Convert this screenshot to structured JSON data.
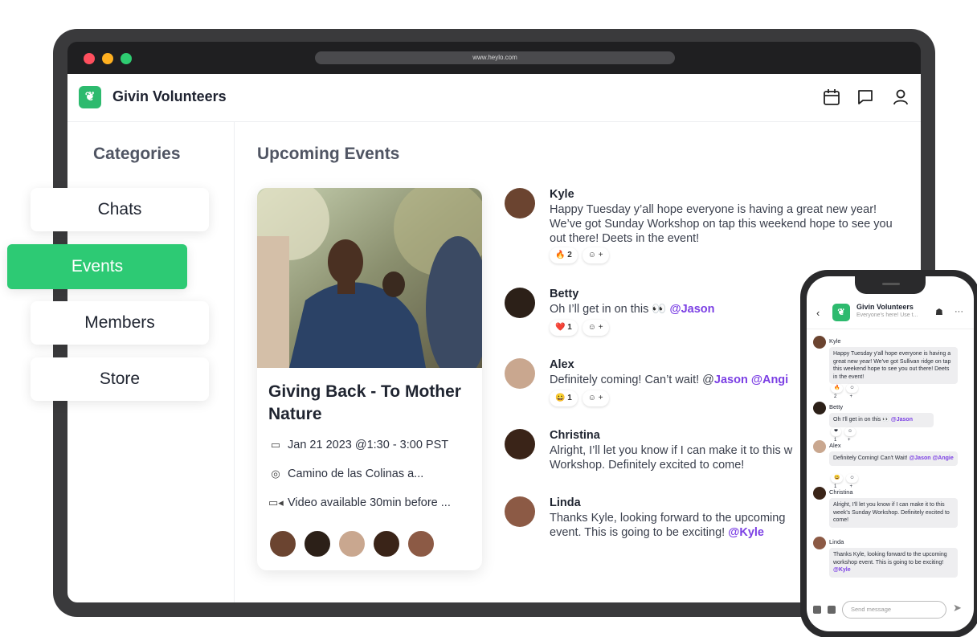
{
  "browser": {
    "url": "www.heylo.com"
  },
  "app": {
    "name": "Givin Volunteers"
  },
  "header_icons": [
    "calendar-icon",
    "chat-bubble-icon",
    "user-icon"
  ],
  "sidebar": {
    "title": "Categories",
    "items": [
      {
        "label": "Chats",
        "active": false
      },
      {
        "label": "Events",
        "active": true
      },
      {
        "label": "Members",
        "active": false
      },
      {
        "label": "Store",
        "active": false
      }
    ]
  },
  "main": {
    "title": "Upcoming Events",
    "event": {
      "name": "Giving Back - To Mother Nature",
      "date": "Jan 21 2023 @1:30 - 3:00 PST",
      "location": "Camino de las Colinas a...",
      "video": "Video available 30min before ..."
    },
    "messages": [
      {
        "name": "Kyle",
        "text": "Happy Tuesday y’all hope everyone is having a great new year! We’ve got Sunday Workshop on tap this weekend hope to see you out there! Deets in the event!",
        "reaction": "🔥",
        "count": "2"
      },
      {
        "name": "Betty",
        "text": "Oh I’ll get in on this 👀 ",
        "mention": "@Jason",
        "reaction": "❤️",
        "count": "1"
      },
      {
        "name": "Alex",
        "text": "Definitely coming! Can’t wait! @",
        "mention": "Jason @Angi",
        "reaction": "😀",
        "count": "1"
      },
      {
        "name": "Christina",
        "text": "Alright, I’ll let you know if I can make it to this w Workshop. Definitely excited to come!"
      },
      {
        "name": "Linda",
        "text": "Thanks Kyle, looking forward to the upcoming event. This is going to be exciting! ",
        "mention": "@Kyle"
      }
    ],
    "add_reaction": "☺ +"
  },
  "phone": {
    "title": "Givin Volunteers",
    "subtitle": "Everyone's here! Use t...",
    "messages": [
      {
        "name": "Kyle",
        "text": "Happy Tuesday y'all hope everyone is having a great new year! We've got Sullivan ridge on tap this weekend hope to see you out there! Deets in the event!",
        "reaction": "🔥 2"
      },
      {
        "name": "Betty",
        "text": "Oh I'll get in on this 👀 ",
        "mention": "@Jason",
        "reaction": "❤ 1"
      },
      {
        "name": "Alex",
        "text": "Definitely Coming! Can't Wait! ",
        "mention": "@Jason @Angie",
        "reaction": "😀 1"
      },
      {
        "name": "Christina",
        "text": "Alright, I'll let you know if I can make it to this week's Sunday Workshop. Definitely excited to come!"
      },
      {
        "name": "Linda",
        "text": "Thanks Kyle, looking forward to the upcoming workshop event. This is going to be exciting! ",
        "mention": "@Kyle"
      }
    ],
    "input_placeholder": "Send message"
  },
  "colors": {
    "accent": "#2dca74",
    "mention": "#7b3fe4",
    "frame": "#3a3a3c"
  }
}
